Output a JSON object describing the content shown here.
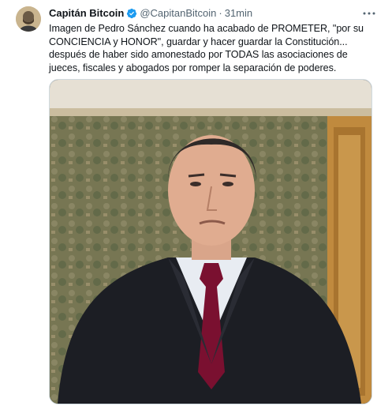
{
  "author": {
    "name": "Capitán Bitcoin",
    "handle": "@CapitanBitcoin",
    "time": "31min",
    "verified": true
  },
  "tweet": {
    "lines": [
      "Imagen de Pedro Sánchez cuando ha acabado de PROMETER, \"por su",
      "CONCIENCIA y HONOR\", guardar y hacer guardar la Constitución...",
      "después de haber sido amonestado por TODAS las asociaciones de",
      "jueces, fiscales y abogados por romper la separación de poderes."
    ]
  },
  "icons": {
    "avatar": "avatar-portrait-icon",
    "verified": "verified-badge-icon",
    "more": "more-options-icon"
  },
  "colors": {
    "verified_badge": "#1d9bf0",
    "text_primary": "#0f1419",
    "text_secondary": "#536471",
    "border": "#cfd9de"
  }
}
